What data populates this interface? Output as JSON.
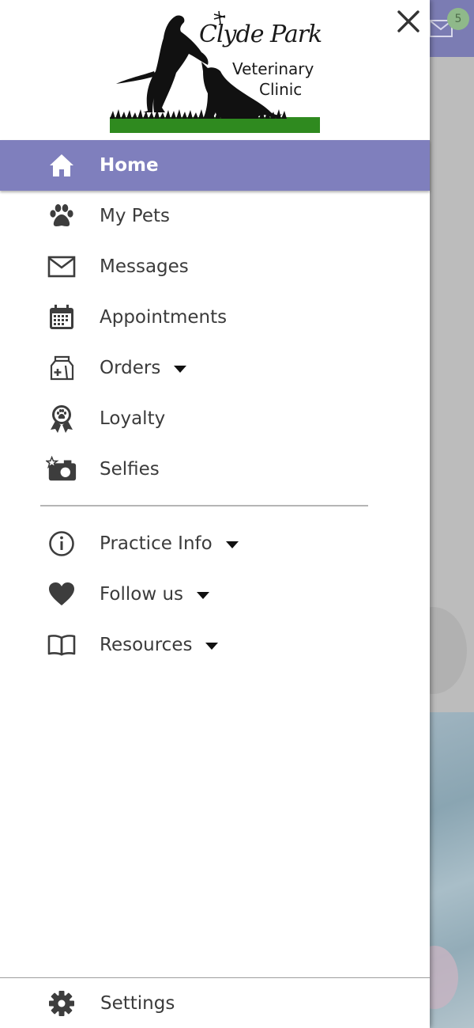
{
  "background": {
    "badge_count": "5",
    "header_color": "#7b7cb3"
  },
  "logo": {
    "line1": "Clyde Park",
    "line2": "Veterinary",
    "line3": "Clinic"
  },
  "close_icon": "close-icon",
  "menu": {
    "items": [
      {
        "label": "Home",
        "icon": "home-icon",
        "active": true
      },
      {
        "label": "My Pets",
        "icon": "paw-icon"
      },
      {
        "label": "Messages",
        "icon": "envelope-icon"
      },
      {
        "label": "Appointments",
        "icon": "calendar-icon"
      },
      {
        "label": "Orders",
        "icon": "pet-food-bag-icon",
        "dropdown": true
      },
      {
        "label": "Loyalty",
        "icon": "award-ribbon-icon"
      },
      {
        "label": "Selfies",
        "icon": "camera-star-icon"
      }
    ],
    "secondary": [
      {
        "label": "Practice Info",
        "icon": "info-icon",
        "dropdown": true
      },
      {
        "label": "Follow us",
        "icon": "heart-icon",
        "dropdown": true
      },
      {
        "label": "Resources",
        "icon": "book-icon",
        "dropdown": true
      }
    ],
    "settings": {
      "label": "Settings",
      "icon": "gear-icon"
    }
  },
  "colors": {
    "active_bg": "#7f7fbd",
    "text": "#3b3b3b",
    "icon": "#3d3d3d"
  }
}
